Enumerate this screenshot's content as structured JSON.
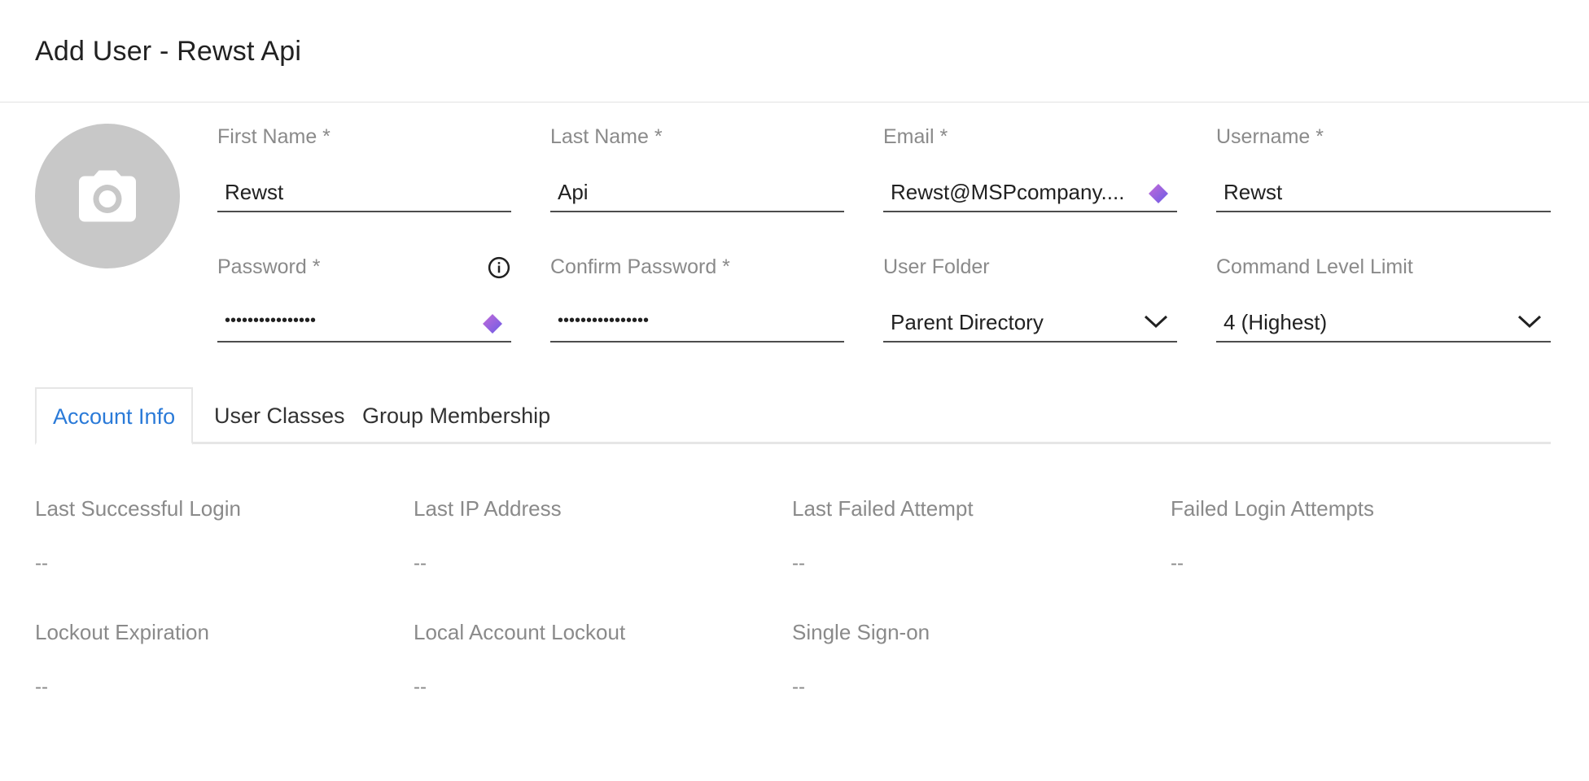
{
  "header": {
    "title": "Add User - Rewst Api"
  },
  "avatar": {
    "icon": "camera-icon"
  },
  "fields": {
    "first_name": {
      "label": "First Name *",
      "value": "Rewst"
    },
    "last_name": {
      "label": "Last Name *",
      "value": "Api"
    },
    "email": {
      "label": "Email *",
      "value": "Rewst@MSPcompany...."
    },
    "username": {
      "label": "Username *",
      "value": "Rewst"
    },
    "password": {
      "label": "Password *",
      "value": "••••••••••••••••"
    },
    "confirm_password": {
      "label": "Confirm Password *",
      "value": "••••••••••••••••"
    },
    "user_folder": {
      "label": "User Folder",
      "value": "Parent Directory"
    },
    "command_level": {
      "label": "Command Level Limit",
      "value": "4 (Highest)"
    }
  },
  "tabs": [
    {
      "label": "Account Info",
      "active": true
    },
    {
      "label": "User Classes",
      "active": false
    },
    {
      "label": "Group Membership",
      "active": false
    }
  ],
  "account_info": [
    {
      "label": "Last Successful Login",
      "value": "--"
    },
    {
      "label": "Last IP Address",
      "value": "--"
    },
    {
      "label": "Last Failed Attempt",
      "value": "--"
    },
    {
      "label": "Failed Login Attempts",
      "value": "--"
    },
    {
      "label": "Lockout Expiration",
      "value": "--"
    },
    {
      "label": "Local Account Lockout",
      "value": "--"
    },
    {
      "label": "Single Sign-on",
      "value": "--"
    }
  ],
  "colors": {
    "accent": "#2a7ad8",
    "label": "#8a8a8a",
    "avatar": "#c8c8c8"
  }
}
